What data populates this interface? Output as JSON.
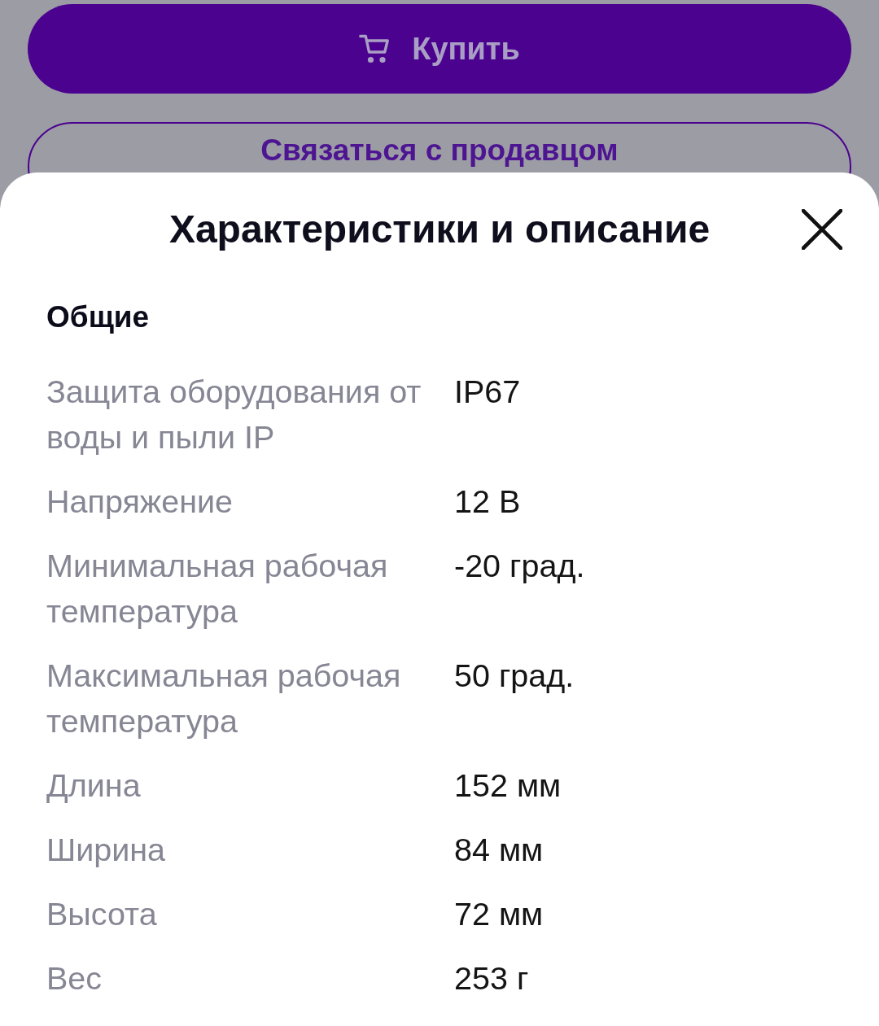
{
  "background": {
    "buttons": [
      {
        "label": "Купить",
        "kind": "primary"
      },
      {
        "label": "Связаться с продавцом",
        "kind": "outline"
      }
    ]
  },
  "sheet": {
    "title": "Характеристики и описание",
    "sections": [
      {
        "heading": "Общие",
        "rows": [
          {
            "label": "Защита оборудования от воды и пыли IP",
            "value": "IP67"
          },
          {
            "label": "Напряжение",
            "value": "12 В"
          },
          {
            "label": "Минимальная рабочая температура",
            "value": "-20 град."
          },
          {
            "label": "Максимальная рабочая температура",
            "value": "50 град."
          },
          {
            "label": "Длина",
            "value": "152 мм"
          },
          {
            "label": "Ширина",
            "value": "84 мм"
          },
          {
            "label": "Высота",
            "value": "72 мм"
          },
          {
            "label": "Вес",
            "value": "253 г"
          }
        ]
      }
    ]
  }
}
